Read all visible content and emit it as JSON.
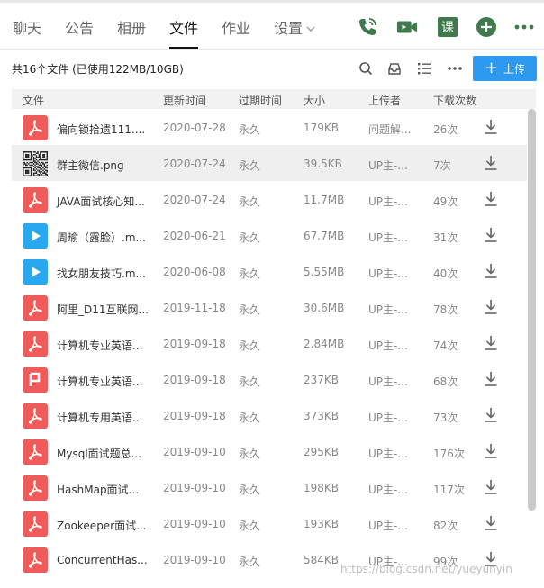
{
  "tabs": [
    {
      "label": "聊天"
    },
    {
      "label": "公告"
    },
    {
      "label": "相册"
    },
    {
      "label": "文件"
    },
    {
      "label": "作业"
    },
    {
      "label": "设置"
    }
  ],
  "header_icons": {
    "phone": "phone-icon",
    "video": "video-icon",
    "course": "课",
    "add": "add-icon",
    "more": "more-icon"
  },
  "toolbar": {
    "summary": "共16个文件 (已使用122MB/10GB)",
    "upload_label": "上传"
  },
  "columns": {
    "name": "文件",
    "updated": "更新时间",
    "expire": "过期时间",
    "size": "大小",
    "uploader": "上传者",
    "downloads": "下载次数"
  },
  "files": [
    {
      "type": "pdf",
      "name": "偏向锁拾遗111....",
      "updated": "2020-07-28",
      "expire": "永久",
      "size": "179KB",
      "uploader": "问题解...",
      "downloads": "26次"
    },
    {
      "type": "qr",
      "name": "群主微信.png",
      "updated": "2020-07-24",
      "expire": "永久",
      "size": "39.5KB",
      "uploader": "UP主-...",
      "downloads": "7次"
    },
    {
      "type": "pdf",
      "name": "JAVA面试核心知...",
      "updated": "2020-07-24",
      "expire": "永久",
      "size": "11.7MB",
      "uploader": "UP主-...",
      "downloads": "49次"
    },
    {
      "type": "video",
      "name": "周瑜（露脸）.m...",
      "updated": "2020-06-21",
      "expire": "永久",
      "size": "67.7MB",
      "uploader": "UP主-...",
      "downloads": "31次"
    },
    {
      "type": "video",
      "name": "找女朋友技巧.m...",
      "updated": "2020-06-08",
      "expire": "永久",
      "size": "5.55MB",
      "uploader": "UP主-...",
      "downloads": "40次"
    },
    {
      "type": "pdf",
      "name": "阿里_D11互联网...",
      "updated": "2019-11-18",
      "expire": "永久",
      "size": "30.6MB",
      "uploader": "UP主-...",
      "downloads": "78次"
    },
    {
      "type": "pdf",
      "name": "计算机专业英语...",
      "updated": "2019-09-18",
      "expire": "永久",
      "size": "2.84MB",
      "uploader": "UP主-...",
      "downloads": "74次"
    },
    {
      "type": "ppt",
      "name": "计算机专业英语...",
      "updated": "2019-09-18",
      "expire": "永久",
      "size": "237KB",
      "uploader": "UP主-...",
      "downloads": "68次"
    },
    {
      "type": "pdf",
      "name": "计算机专用英语...",
      "updated": "2019-09-18",
      "expire": "永久",
      "size": "373KB",
      "uploader": "UP主-...",
      "downloads": "73次"
    },
    {
      "type": "pdf",
      "name": "Mysql面试题总...",
      "updated": "2019-09-10",
      "expire": "永久",
      "size": "295KB",
      "uploader": "UP主-...",
      "downloads": "176次"
    },
    {
      "type": "pdf",
      "name": "HashMap面试...",
      "updated": "2019-09-10",
      "expire": "永久",
      "size": "198KB",
      "uploader": "UP主-...",
      "downloads": "117次"
    },
    {
      "type": "pdf",
      "name": "Zookeeper面试...",
      "updated": "2019-09-10",
      "expire": "永久",
      "size": "193KB",
      "uploader": "UP主-...",
      "downloads": "82次"
    },
    {
      "type": "pdf",
      "name": "ConcurrentHas...",
      "updated": "2019-09-10",
      "expire": "永久",
      "size": "584KB",
      "uploader": "UP主-...",
      "downloads": "99次"
    }
  ],
  "watermark": "https://blog.csdn.net/yueyunyin",
  "colors": {
    "pdf": "#ef5b5b",
    "video": "#29a7ef",
    "accent": "#2d9af0",
    "header_icon": "#3f7a4c"
  }
}
